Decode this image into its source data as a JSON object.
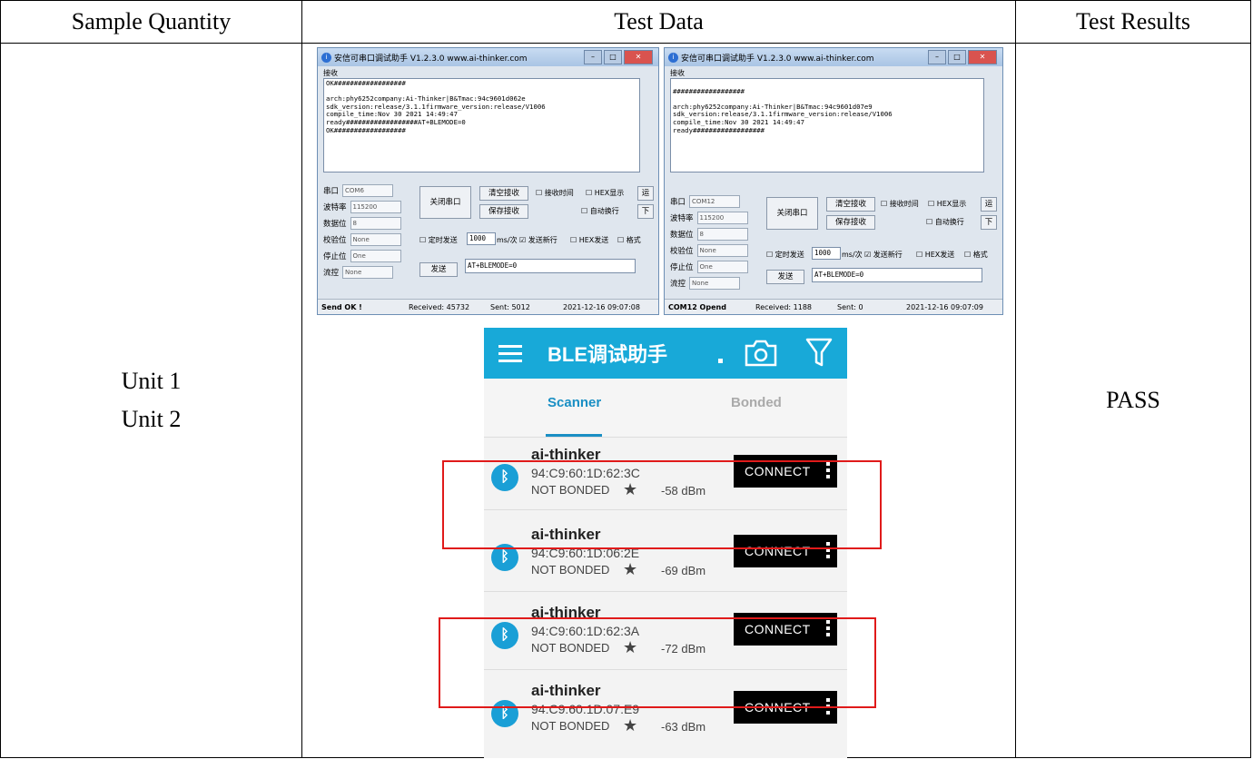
{
  "table": {
    "headers": [
      "Sample Quantity",
      "Test Data",
      "Test Results"
    ],
    "units": [
      "Unit 1",
      "Unit 2"
    ],
    "result": "PASS"
  },
  "serial_windows": [
    {
      "title": "安信可串口调试助手 V1.2.3.0   www.ai-thinker.com",
      "recv_label": "接收",
      "recv_text": "OK##################\n\narch:phy6252company:Ai-Thinker|B&Tmac:94c9601d062e\nsdk_version:release/3.1.1firmware_version:release/V1006\ncompile_time:Nov 30 2021 14:49:47\nready##################AT+BLEMODE=0\nOK##################",
      "port_label": "串口",
      "port_value": "COM6",
      "baud_label": "波特率",
      "baud_value": "115200",
      "data_label": "数据位",
      "data_value": "8",
      "parity_label": "校验位",
      "parity_value": "None",
      "stop_label": "停止位",
      "stop_value": "One",
      "flow_label": "流控",
      "flow_value": "None",
      "close_port": "关闭串口",
      "clear_recv": "清空接收",
      "save_recv": "保存接收",
      "recv_time": "接收时间",
      "hex_show": "HEX显示",
      "run": "运",
      "auto_wrap": "自动换行",
      "down": "下",
      "timed_send": "定时发送",
      "interval": "1000",
      "interval_unit": "ms/次",
      "send_newline": "发送新行",
      "hex_send": "HEX发送",
      "format": "格式",
      "send_btn": "发送",
      "send_text": "AT+BLEMODE=0",
      "status_left": "Send OK !",
      "received": "Received: 45732",
      "sent": "Sent: 5012",
      "time": "2021-12-16 09:07:08"
    },
    {
      "title": "安信可串口调试助手 V1.2.3.0   www.ai-thinker.com",
      "recv_label": "接收",
      "recv_text": "\n##################\n\narch:phy6252company:Ai-Thinker|B&Tmac:94c9601d07e9\nsdk_version:release/3.1.1firmware_version:release/V1006\ncompile_time:Nov 30 2021 14:49:47\nready##################",
      "port_label": "串口",
      "port_value": "COM12",
      "baud_label": "波特率",
      "baud_value": "115200",
      "data_label": "数据位",
      "data_value": "8",
      "parity_label": "校验位",
      "parity_value": "None",
      "stop_label": "停止位",
      "stop_value": "One",
      "flow_label": "流控",
      "flow_value": "None",
      "close_port": "关闭串口",
      "clear_recv": "清空接收",
      "save_recv": "保存接收",
      "recv_time": "接收时间",
      "hex_show": "HEX显示",
      "run": "运",
      "auto_wrap": "自动换行",
      "down": "下",
      "timed_send": "定时发送",
      "interval": "1000",
      "interval_unit": "ms/次",
      "send_newline": "发送新行",
      "hex_send": "HEX发送",
      "format": "格式",
      "send_btn": "发送",
      "send_text": "AT+BLEMODE=0",
      "status_left": "COM12 Opend",
      "received": "Received: 1188",
      "sent": "Sent: 0",
      "time": "2021-12-16 09:07:09"
    }
  ],
  "ble_app": {
    "title": "BLE调试助手",
    "tabs": [
      "Scanner",
      "Bonded"
    ],
    "devices": [
      {
        "name": "ai-thinker",
        "mac": "94:C9:60:1D:62:3C",
        "bond": "NOT BONDED",
        "rssi": "-58 dBm",
        "connect": "CONNECT",
        "highlighted": false
      },
      {
        "name": "ai-thinker",
        "mac": "94:C9:60:1D:06:2E",
        "bond": "NOT BONDED",
        "rssi": "-69 dBm",
        "connect": "CONNECT",
        "highlighted": true
      },
      {
        "name": "ai-thinker",
        "mac": "94:C9:60:1D:62:3A",
        "bond": "NOT BONDED",
        "rssi": "-72 dBm",
        "connect": "CONNECT",
        "highlighted": false
      },
      {
        "name": "ai-thinker",
        "mac": "94:C9:60:1D:07:E9",
        "bond": "NOT BONDED",
        "rssi": "-63 dBm",
        "connect": "CONNECT",
        "highlighted": true
      }
    ],
    "accent": "#18a9d8",
    "highlight_color": "#e01a1a"
  }
}
